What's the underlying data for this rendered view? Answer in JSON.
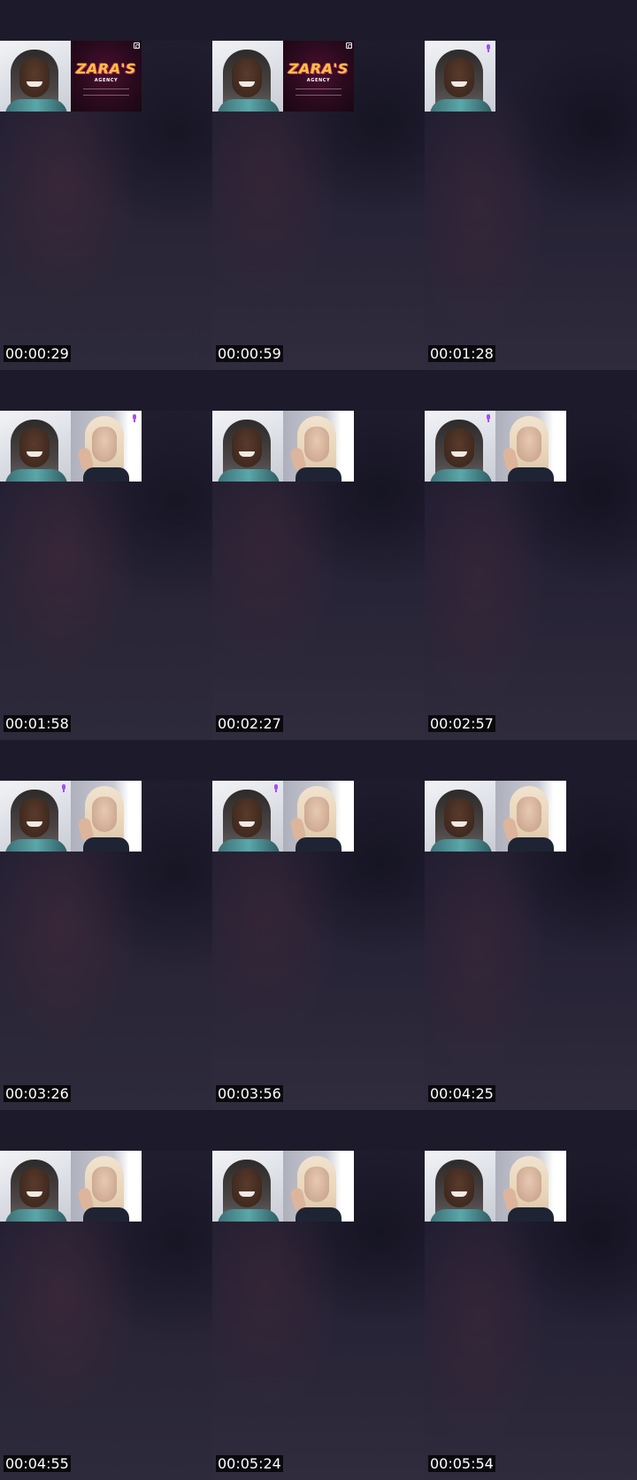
{
  "frames": [
    {
      "time": "00:00:29",
      "tiles": [
        {
          "kind": "host",
          "mic": false
        },
        {
          "kind": "brand",
          "brand_text": "ZARA'S",
          "brand_sub": "AGENCY",
          "corner_icon": "screen-share-icon"
        }
      ]
    },
    {
      "time": "00:00:59",
      "tiles": [
        {
          "kind": "host",
          "mic": false
        },
        {
          "kind": "brand",
          "brand_text": "ZARA'S",
          "brand_sub": "AGENCY",
          "corner_icon": "screen-share-icon"
        }
      ]
    },
    {
      "time": "00:01:28",
      "tiles": [
        {
          "kind": "host",
          "mic": true
        }
      ]
    },
    {
      "time": "00:01:58",
      "tiles": [
        {
          "kind": "host",
          "mic": false
        },
        {
          "kind": "guest",
          "mic": true
        }
      ]
    },
    {
      "time": "00:02:27",
      "tiles": [
        {
          "kind": "host",
          "mic": false
        },
        {
          "kind": "guest",
          "mic": false
        }
      ]
    },
    {
      "time": "00:02:57",
      "tiles": [
        {
          "kind": "host",
          "mic": true
        },
        {
          "kind": "guest",
          "mic": false
        }
      ]
    },
    {
      "time": "00:03:26",
      "tiles": [
        {
          "kind": "host",
          "mic": true
        },
        {
          "kind": "guest",
          "mic": false
        }
      ]
    },
    {
      "time": "00:03:56",
      "tiles": [
        {
          "kind": "host",
          "mic": true
        },
        {
          "kind": "guest",
          "mic": false
        }
      ]
    },
    {
      "time": "00:04:25",
      "tiles": [
        {
          "kind": "host",
          "mic": false
        },
        {
          "kind": "guest",
          "mic": false
        }
      ]
    },
    {
      "time": "00:04:55",
      "tiles": [
        {
          "kind": "host",
          "mic": false
        },
        {
          "kind": "guest",
          "mic": false
        }
      ]
    },
    {
      "time": "00:05:24",
      "tiles": [
        {
          "kind": "host",
          "mic": false
        },
        {
          "kind": "guest",
          "mic": false
        }
      ]
    },
    {
      "time": "00:05:54",
      "tiles": [
        {
          "kind": "host",
          "mic": false
        },
        {
          "kind": "guest",
          "mic": false
        }
      ]
    }
  ],
  "colors": {
    "background": "#1c1a2a",
    "mic_active": "#a64df0",
    "brand_gold": "#f7c33b",
    "brand_bg": "#2b0a1e",
    "timestamp_bg": "#000000",
    "timestamp_text": "#ffffff"
  }
}
